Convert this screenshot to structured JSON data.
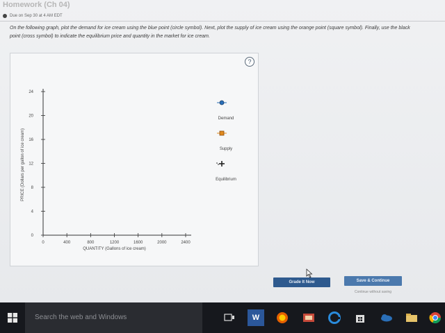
{
  "assignment": {
    "title": "Homework (Ch 04)",
    "due": "Due on Sep 30 at 4 AM EDT"
  },
  "instructions": "On the following graph, plot the demand for ice cream using the blue point (circle symbol). Next, plot the supply of ice cream using the orange point (square symbol). Finally, use the black point (cross symbol) to indicate the equilibrium price and quantity in the market for ice cream.",
  "help": {
    "label": "?"
  },
  "graph": {
    "x_axis": {
      "title": "QUANTITY (Gallons of ice cream)",
      "ticks": [
        "0",
        "400",
        "800",
        "1200",
        "1600",
        "2000",
        "2400"
      ],
      "range": [
        0,
        2400
      ]
    },
    "y_axis": {
      "title": "PRICE (Dollars per gallon of ice cream)",
      "ticks": [
        "0",
        "4",
        "8",
        "12",
        "16",
        "20",
        "24"
      ],
      "range": [
        0,
        24
      ]
    },
    "tools": [
      {
        "label": "Demand",
        "symbol": "circle",
        "color": "#2a6fb8"
      },
      {
        "label": "Supply",
        "symbol": "square",
        "color": "#e08a1e"
      },
      {
        "label": "Equilibrium",
        "symbol": "cross",
        "color": "#222222"
      }
    ]
  },
  "buttons": {
    "grade": "Grade It Now",
    "save": "Save & Continue",
    "continue_without_saving": "Continue without saving"
  },
  "taskbar": {
    "search_placeholder": "Search the web and Windows",
    "icons": [
      "task-view-icon",
      "word-icon",
      "firefox-icon",
      "photos-icon",
      "edge-icon",
      "store-icon",
      "onedrive-icon",
      "file-explorer-icon",
      "chrome-icon"
    ]
  },
  "colors": {
    "grade_button": "#2e5a8e",
    "save_button": "#4b79ad",
    "taskbar": "#16181d"
  }
}
